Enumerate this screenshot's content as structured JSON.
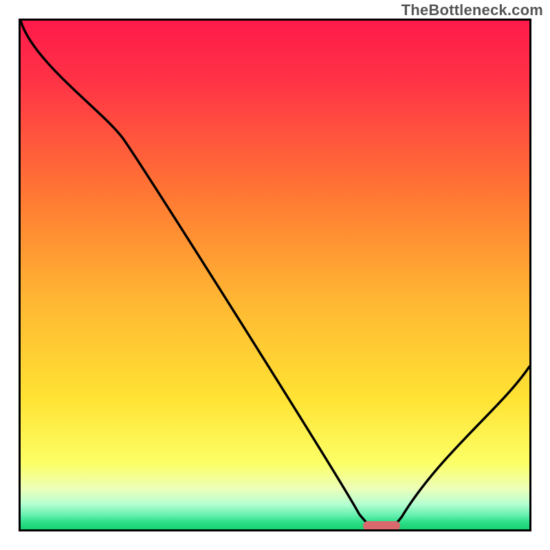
{
  "watermark": "TheBottleneck.com",
  "chart_data": {
    "type": "line",
    "title": "",
    "xlabel": "",
    "ylabel": "",
    "xlim": [
      0,
      100
    ],
    "ylim": [
      0,
      100
    ],
    "x": [
      0,
      20,
      69,
      73,
      100
    ],
    "series": [
      {
        "name": "bottleneck-curve",
        "values": [
          100,
          77,
          0,
          0,
          32
        ]
      }
    ],
    "marker": {
      "x": 71,
      "y": 0
    },
    "background_gradient": {
      "stops": [
        {
          "offset": 0.0,
          "color": "#ff1a4a"
        },
        {
          "offset": 0.12,
          "color": "#ff3346"
        },
        {
          "offset": 0.35,
          "color": "#ff7a33"
        },
        {
          "offset": 0.55,
          "color": "#ffb733"
        },
        {
          "offset": 0.74,
          "color": "#ffe233"
        },
        {
          "offset": 0.87,
          "color": "#fcff66"
        },
        {
          "offset": 0.92,
          "color": "#ecffb8"
        },
        {
          "offset": 0.95,
          "color": "#b6ffd2"
        },
        {
          "offset": 0.972,
          "color": "#66f0b0"
        },
        {
          "offset": 0.985,
          "color": "#2ee08a"
        },
        {
          "offset": 1.0,
          "color": "#18d070"
        }
      ]
    }
  }
}
